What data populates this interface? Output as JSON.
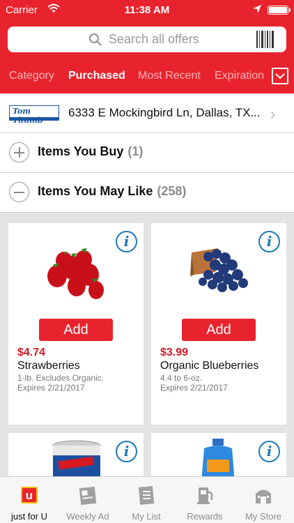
{
  "status_bar": {
    "carrier": "Carrier",
    "time": "11:38 AM",
    "battery_level": 1.0
  },
  "search": {
    "placeholder": "Search all offers"
  },
  "tabs": [
    {
      "label": "Category",
      "active": false
    },
    {
      "label": "Purchased",
      "active": true
    },
    {
      "label": "Most Recent",
      "active": false
    },
    {
      "label": "Expiration",
      "active": false
    }
  ],
  "store": {
    "logo_text": "Tom Thumb",
    "address": "6333 E Mockingbird Ln, Dallas, TX..."
  },
  "groups": [
    {
      "title": "Items You Buy",
      "count": "(1)",
      "expanded": false
    },
    {
      "title": "Items You May Like",
      "count": "(258)",
      "expanded": true
    }
  ],
  "products": [
    {
      "price": "$4.74",
      "name": "Strawberries",
      "description": "1-lb. Excludes Organic.",
      "expires": "Expires 2/21/2017",
      "add_label": "Add",
      "image": "strawberries"
    },
    {
      "price": "$3.99",
      "name": "Organic Blueberries",
      "description": "4.4 to 6-oz.",
      "expires": "Expires 2/21/2017",
      "add_label": "Add",
      "image": "blueberries"
    },
    {
      "image": "swanson-broth-can"
    },
    {
      "image": "detergent-bottle"
    }
  ],
  "bottom_nav": [
    {
      "label": "just for U",
      "icon": "just-for-u-icon",
      "active": true
    },
    {
      "label": "Weekly Ad",
      "icon": "weekly-ad-icon",
      "active": false
    },
    {
      "label": "My List",
      "icon": "my-list-icon",
      "active": false
    },
    {
      "label": "Rewards",
      "icon": "rewards-icon",
      "active": false
    },
    {
      "label": "My Store",
      "icon": "my-store-icon",
      "active": false
    }
  ],
  "colors": {
    "brand_red": "#e8232d",
    "price_red": "#d71920",
    "info_blue": "#1d78b6",
    "logo_blue": "#1c57a5"
  }
}
